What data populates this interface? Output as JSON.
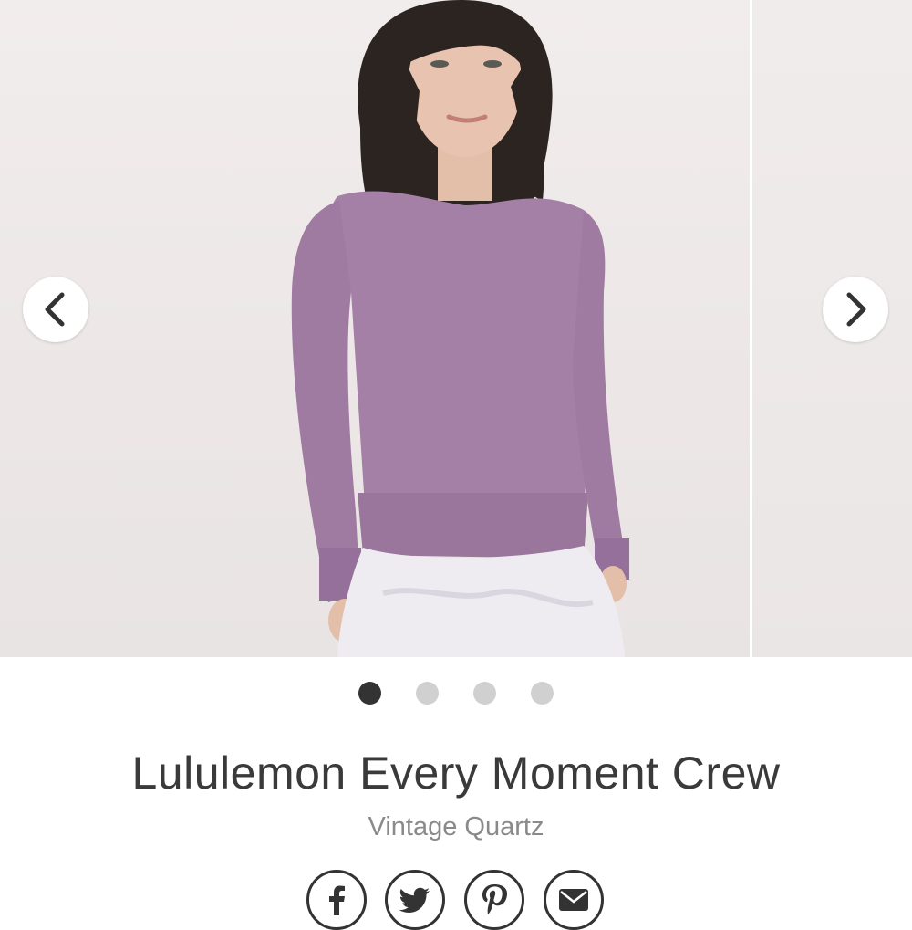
{
  "carousel": {
    "prev_icon": "chevron-left-icon",
    "next_icon": "chevron-right-icon",
    "slide_count": 4,
    "active_index": 0,
    "dot_color_active": "#333333",
    "dot_color_inactive": "#d0d0d0",
    "photo": {
      "sweater_color": "#a47fa6",
      "pants_color": "#eeecf1",
      "hair_color": "#2c2420",
      "skin_color": "#e8c4b0",
      "background_color": "#eee8e8"
    }
  },
  "product": {
    "name": "Lululemon Every Moment Crew",
    "color": "Vintage Quartz"
  },
  "share": {
    "icons": [
      "facebook-icon",
      "twitter-icon",
      "pinterest-icon",
      "email-icon"
    ],
    "border_color": "#333333"
  }
}
